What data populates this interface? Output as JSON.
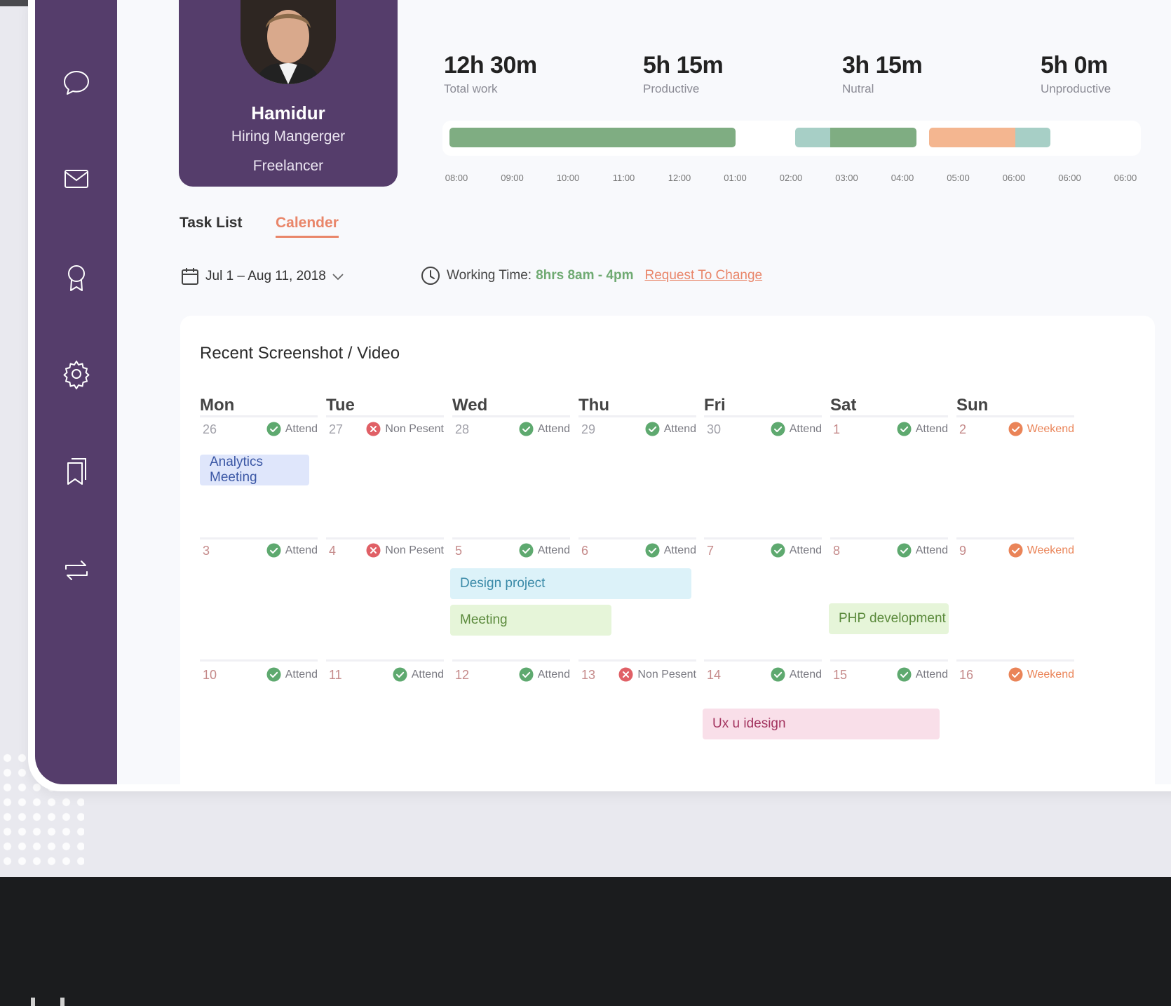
{
  "colors": {
    "sidebar": "#553d6b",
    "accent": "#e9866a",
    "productive": "#7fad82",
    "neutral": "#a7cfc6",
    "unproductive": "#f4b690",
    "attend": "#5ea96f",
    "absent": "#e06066",
    "weekend": "#ea8458"
  },
  "sidebar": {
    "items": [
      {
        "icon": "chat-icon"
      },
      {
        "icon": "mail-icon"
      },
      {
        "icon": "award-icon"
      },
      {
        "icon": "gear-icon"
      },
      {
        "icon": "bookmark-icon"
      },
      {
        "icon": "transfer-icon"
      }
    ]
  },
  "profile": {
    "name": "Hamidur",
    "role": "Hiring Mangerger",
    "type": "Freelancer"
  },
  "stats": [
    {
      "value": "12h 30m",
      "label": "Total work"
    },
    {
      "value": "5h 15m",
      "label": "Productive"
    },
    {
      "value": "3h 15m",
      "label": "Nutral"
    },
    {
      "value": "5h 0m",
      "label": "Unproductive"
    }
  ],
  "timeline": {
    "ticks": [
      "08:00",
      "09:00",
      "10:00",
      "11:00",
      "12:00",
      "01:00",
      "02:00",
      "03:00",
      "04:00",
      "05:00",
      "06:00",
      "06:00",
      "06:00"
    ]
  },
  "tabs": {
    "task_list": "Task List",
    "calender": "Calender"
  },
  "filters": {
    "date_range": "Jul 1 – Aug 11, 2018",
    "working_label": "Working Time:",
    "working_hours": "8hrs 8am - 4pm",
    "request_link": "Request To Change"
  },
  "calendar": {
    "title": "Recent Screenshot / Video",
    "days": [
      "Mon",
      "Tue",
      "Wed",
      "Thu",
      "Fri",
      "Sat",
      "Sun"
    ],
    "weeks": [
      [
        {
          "num": "26",
          "status": "Attend",
          "type": "attend"
        },
        {
          "num": "27",
          "status": "Non Pesent",
          "type": "absent"
        },
        {
          "num": "28",
          "status": "Attend",
          "type": "attend"
        },
        {
          "num": "29",
          "status": "Attend",
          "type": "attend"
        },
        {
          "num": "30",
          "status": "Attend",
          "type": "attend"
        },
        {
          "num": "1",
          "status": "Attend",
          "type": "attend"
        },
        {
          "num": "2",
          "status": "Weekend",
          "type": "weekend"
        }
      ],
      [
        {
          "num": "3",
          "status": "Attend",
          "type": "attend"
        },
        {
          "num": "4",
          "status": "Non Pesent",
          "type": "absent"
        },
        {
          "num": "5",
          "status": "Attend",
          "type": "attend"
        },
        {
          "num": "6",
          "status": "Attend",
          "type": "attend"
        },
        {
          "num": "7",
          "status": "Attend",
          "type": "attend"
        },
        {
          "num": "8",
          "status": "Attend",
          "type": "attend"
        },
        {
          "num": "9",
          "status": "Weekend",
          "type": "weekend"
        }
      ],
      [
        {
          "num": "10",
          "status": "Attend",
          "type": "attend"
        },
        {
          "num": "11",
          "status": "Attend",
          "type": "attend"
        },
        {
          "num": "12",
          "status": "Attend",
          "type": "attend"
        },
        {
          "num": "13",
          "status": "Non Pesent",
          "type": "absent"
        },
        {
          "num": "14",
          "status": "Attend",
          "type": "attend"
        },
        {
          "num": "15",
          "status": "Attend",
          "type": "attend"
        },
        {
          "num": "16",
          "status": "Weekend",
          "type": "weekend"
        }
      ]
    ],
    "events": [
      {
        "label": "Analytics Meeting",
        "bg": "#dfe6fb",
        "fg": "#3b57a5"
      },
      {
        "label": "Design project",
        "bg": "#dcf2f9",
        "fg": "#3a8aa8"
      },
      {
        "label": "Meeting",
        "bg": "#e6f5d9",
        "fg": "#5b8a3c"
      },
      {
        "label": "PHP development",
        "bg": "#e6f5d9",
        "fg": "#5b8a3c"
      },
      {
        "label": "Ux u idesign",
        "bg": "#f9dfe9",
        "fg": "#a3345f"
      }
    ]
  }
}
